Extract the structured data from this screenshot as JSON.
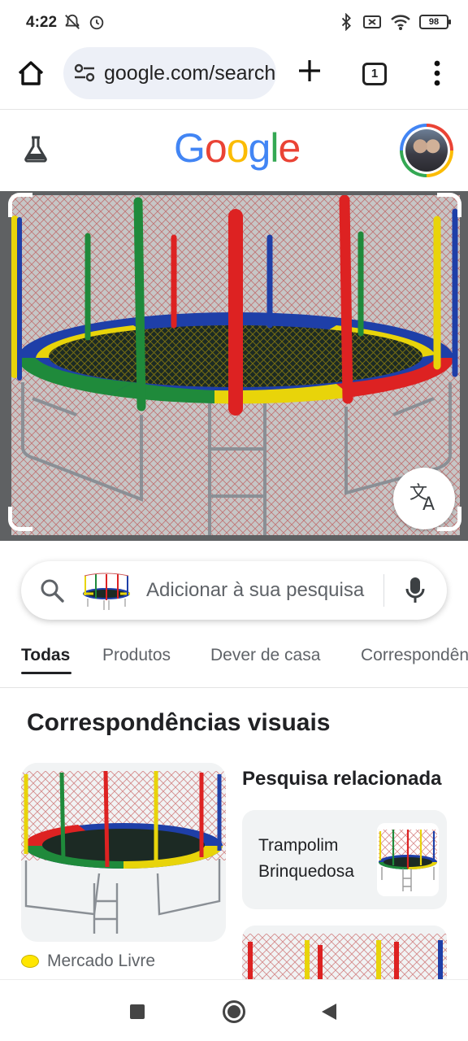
{
  "status_bar": {
    "time": "4:22",
    "battery": "98"
  },
  "browser": {
    "url": "google.com/search",
    "tab_count": "1"
  },
  "google": {
    "logo_letters": [
      "G",
      "o",
      "o",
      "g",
      "l",
      "e"
    ],
    "logo_colors": [
      "#4285f4",
      "#ea4335",
      "#fbbc05",
      "#4285f4",
      "#34a853",
      "#ea4335"
    ]
  },
  "search": {
    "placeholder": "Adicionar à sua pesquisa"
  },
  "tabs": [
    {
      "label": "Todas",
      "active": true
    },
    {
      "label": "Produtos",
      "active": false
    },
    {
      "label": "Dever de casa",
      "active": false
    },
    {
      "label": "Correspondências",
      "active": false
    }
  ],
  "results": {
    "section_title": "Correspondências visuais",
    "first_result_source": "Mercado Livre",
    "related_title": "Pesquisa relacionada",
    "related_item": "Trampolim Brinquedosa"
  },
  "icons": {
    "home": "home-icon",
    "tune": "site-settings-icon",
    "new_tab": "plus-icon",
    "menu": "more-vert-icon",
    "labs": "flask-icon",
    "search": "search-icon",
    "mic": "mic-icon",
    "translate": "translate-icon"
  }
}
